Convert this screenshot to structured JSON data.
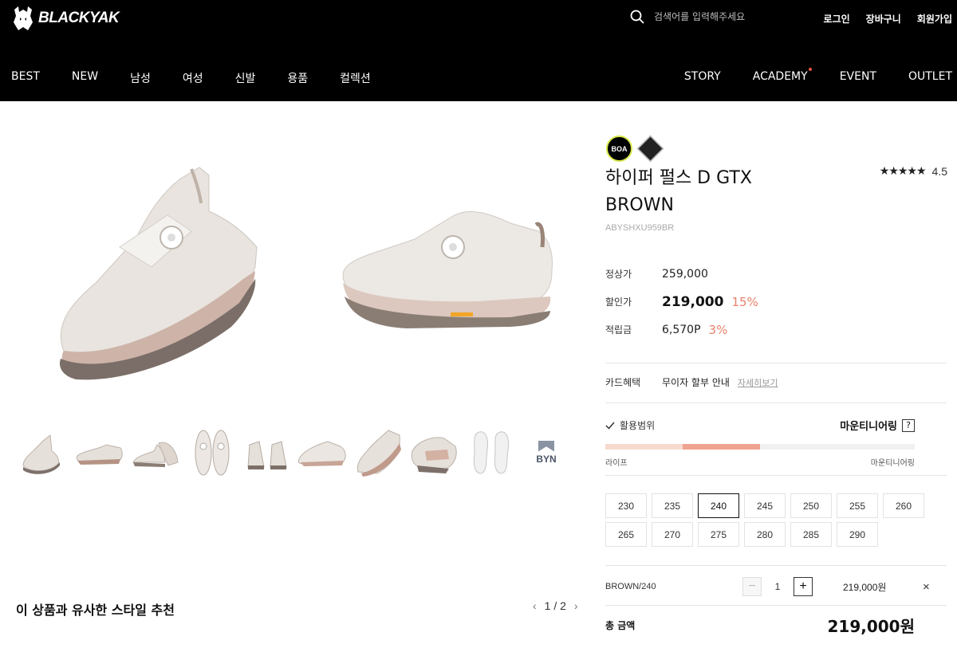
{
  "brand": {
    "name": "BLACKYAK"
  },
  "search": {
    "placeholder": "검색어를 입력해주세요"
  },
  "util_links": [
    "로그인",
    "장바구니",
    "회원가입"
  ],
  "nav_left": [
    "BEST",
    "NEW",
    "남성",
    "여성",
    "신발",
    "용품",
    "컬렉션"
  ],
  "nav_right": [
    "STORY",
    "ACADEMY",
    "EVENT",
    "OUTLET"
  ],
  "badges": {
    "boa": "BOA"
  },
  "product": {
    "name_line1": "하이퍼 펄스 D GTX",
    "name_line2": "BROWN",
    "code": "ABYSHXU959BR",
    "rating": "4.5",
    "stars": "★★★★★"
  },
  "prices": {
    "regular_label": "정상가",
    "regular_value": "259,000",
    "sale_label": "할인가",
    "sale_value": "219,000",
    "sale_rate": "15%",
    "points_label": "적립금",
    "points_value": "6,570P",
    "points_rate": "3%"
  },
  "card": {
    "label": "카드혜택",
    "value": "무이자 할부 안내",
    "more": "자세히보기"
  },
  "usage_range": {
    "label": "활용범위",
    "level_name": "마운티니어링",
    "help": "?",
    "min_label": "라이프",
    "max_label": "마운티니어링",
    "fill_fraction": 0.5
  },
  "sizes": [
    "230",
    "235",
    "240",
    "245",
    "250",
    "255",
    "260",
    "265",
    "270",
    "275",
    "280",
    "285",
    "290"
  ],
  "selected_size": "240",
  "thumbnails": {
    "last_logo": "BYN"
  },
  "option": {
    "name": "BROWN/240",
    "qty": "1",
    "minus": "−",
    "plus": "+",
    "price": "219,000원",
    "remove": "×"
  },
  "total": {
    "label": "총 금액",
    "value": "219,000원"
  },
  "recommend": {
    "title": "이 상품과 유사한 스타일 추천",
    "page": "1 / 2",
    "prev": "‹",
    "next": "›"
  },
  "colors": {
    "accent": "#e8836b",
    "header_bg": "#000000",
    "shoe_body": "#e7e1dc",
    "shoe_accent": "#b98f80"
  }
}
